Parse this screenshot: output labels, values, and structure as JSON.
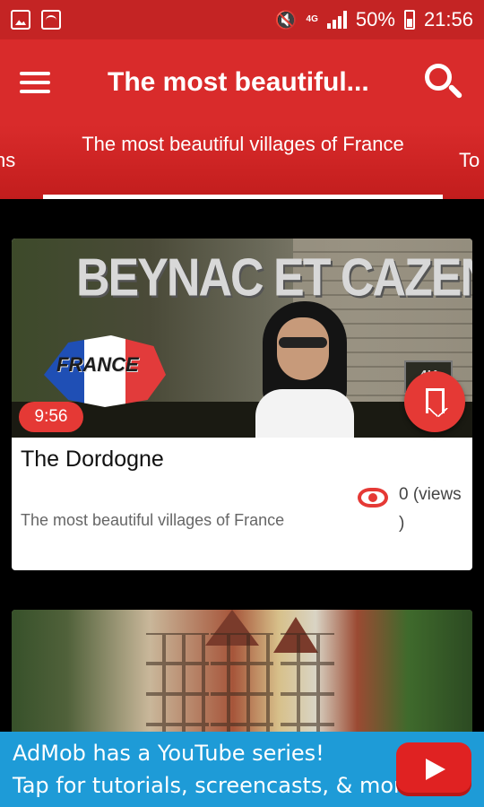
{
  "status_bar": {
    "battery": "50%",
    "time": "21:56",
    "network": "4G"
  },
  "app_bar": {
    "title": "The most beautiful..."
  },
  "tabs": {
    "left_partial": "ns",
    "active": "The most beautiful villages of France",
    "right_partial": "To"
  },
  "videos": [
    {
      "thumbnail_title": "BEYNAC ET CAZENAC",
      "thumbnail_flag_label": "FRANCE",
      "thumbnail_badge": "4K",
      "duration": "9:56",
      "title": "The Dordogne",
      "category": "The most beautiful villages of France",
      "views": "0 (views )"
    },
    {
      "thumbnail_title": "",
      "duration": "",
      "title": "",
      "category": "",
      "views": ""
    }
  ],
  "ad": {
    "line1": "AdMob has a YouTube series!",
    "line2": "Tap for tutorials, screencasts, & more."
  },
  "colors": {
    "primary": "#d92b2b",
    "status_bar": "#c42424",
    "accent": "#e53935",
    "ad_background": "#1e9bd7"
  }
}
